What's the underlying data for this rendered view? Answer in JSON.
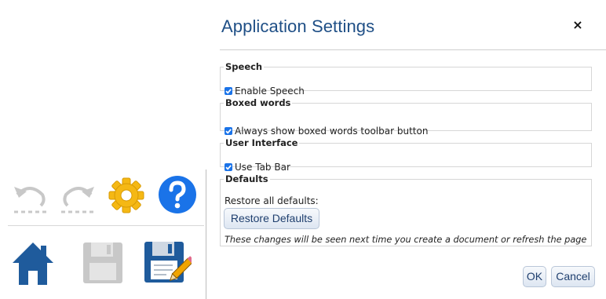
{
  "dialog": {
    "title": "Application Settings",
    "close_label": "×"
  },
  "groups": {
    "speech": {
      "legend": "Speech",
      "option_label": "Enable Speech",
      "checked": true
    },
    "boxed_words": {
      "legend": "Boxed words",
      "option_label": "Always show boxed words toolbar button",
      "checked": true
    },
    "user_interface": {
      "legend": "User Interface",
      "option_label": "Use Tab Bar",
      "checked": true
    },
    "defaults": {
      "legend": "Defaults",
      "restore_text": "Restore all defaults:",
      "restore_button": "Restore Defaults",
      "note": "These changes will be seen next time you create a document or refresh the page"
    }
  },
  "footer": {
    "ok_label": "OK",
    "cancel_label": "Cancel"
  },
  "toolbar": {
    "buttons": [
      {
        "icon": "undo-icon",
        "enabled": false
      },
      {
        "icon": "redo-icon",
        "enabled": false
      },
      {
        "icon": "gear-icon",
        "enabled": true
      },
      {
        "icon": "help-icon",
        "enabled": true
      },
      {
        "icon": "home-icon",
        "enabled": true
      },
      {
        "icon": "save-icon",
        "enabled": false
      },
      {
        "icon": "save-as-icon",
        "enabled": true
      }
    ]
  },
  "colors": {
    "title": "#1f4f86",
    "checkbox": "#1a73e8",
    "gear": "#f5b814",
    "help": "#1a73e8",
    "home": "#1f5b9c"
  }
}
